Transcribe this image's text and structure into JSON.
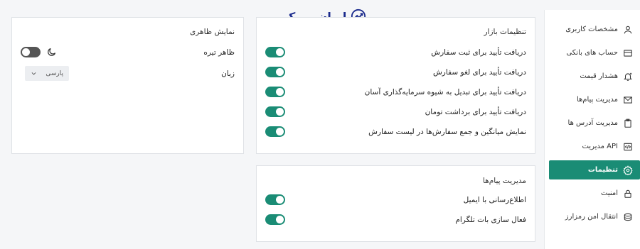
{
  "brand": {
    "name": "ایران بروکر"
  },
  "sidebar": {
    "items": [
      {
        "label": "مشخصات کاربری",
        "icon": "user-icon"
      },
      {
        "label": "حساب های بانکی",
        "icon": "credit-card-icon"
      },
      {
        "label": "هشدار قیمت",
        "icon": "bell-plus-icon"
      },
      {
        "label": "مدیریت پیام‌ها",
        "icon": "mail-icon"
      },
      {
        "label": "مدیریت آدرس ها",
        "icon": "clipboard-icon"
      },
      {
        "label": "مدیریت API",
        "icon": "code-icon"
      },
      {
        "label": "تنظیمات",
        "icon": "gear-icon",
        "active": true
      },
      {
        "label": "امنیت",
        "icon": "lock-icon"
      },
      {
        "label": "انتقال امن رمزارز",
        "icon": "database-icon"
      }
    ]
  },
  "market_settings": {
    "title": "تنظیمات بازار",
    "rows": [
      {
        "label": "دریافت تأیید برای ثبت سفارش",
        "on": true
      },
      {
        "label": "دریافت تأیید برای لغو سفارش",
        "on": true
      },
      {
        "label": "دریافت تأیید برای تبدیل به شیوه سرمایه‌گذاری آسان",
        "on": true
      },
      {
        "label": "دریافت تأیید برای برداشت تومان",
        "on": true
      },
      {
        "label": "نمایش میانگین و جمع سفارش‌ها در لیست سفارش",
        "on": true
      }
    ]
  },
  "message_settings": {
    "title": "مدیریت پیام‌ها",
    "rows": [
      {
        "label": "اطلاع‌رسانی با ایمیل",
        "on": true
      },
      {
        "label": "فعال سازی بات تلگرام",
        "on": true
      }
    ]
  },
  "appearance": {
    "title": "نمایش ظاهری",
    "dark_mode_label": "ظاهر تیره",
    "dark_mode_on": false,
    "language_label": "زبان",
    "language_value": "پارسی"
  },
  "colors": {
    "accent": "#1a8c75",
    "brand": "#1a2a8c"
  }
}
